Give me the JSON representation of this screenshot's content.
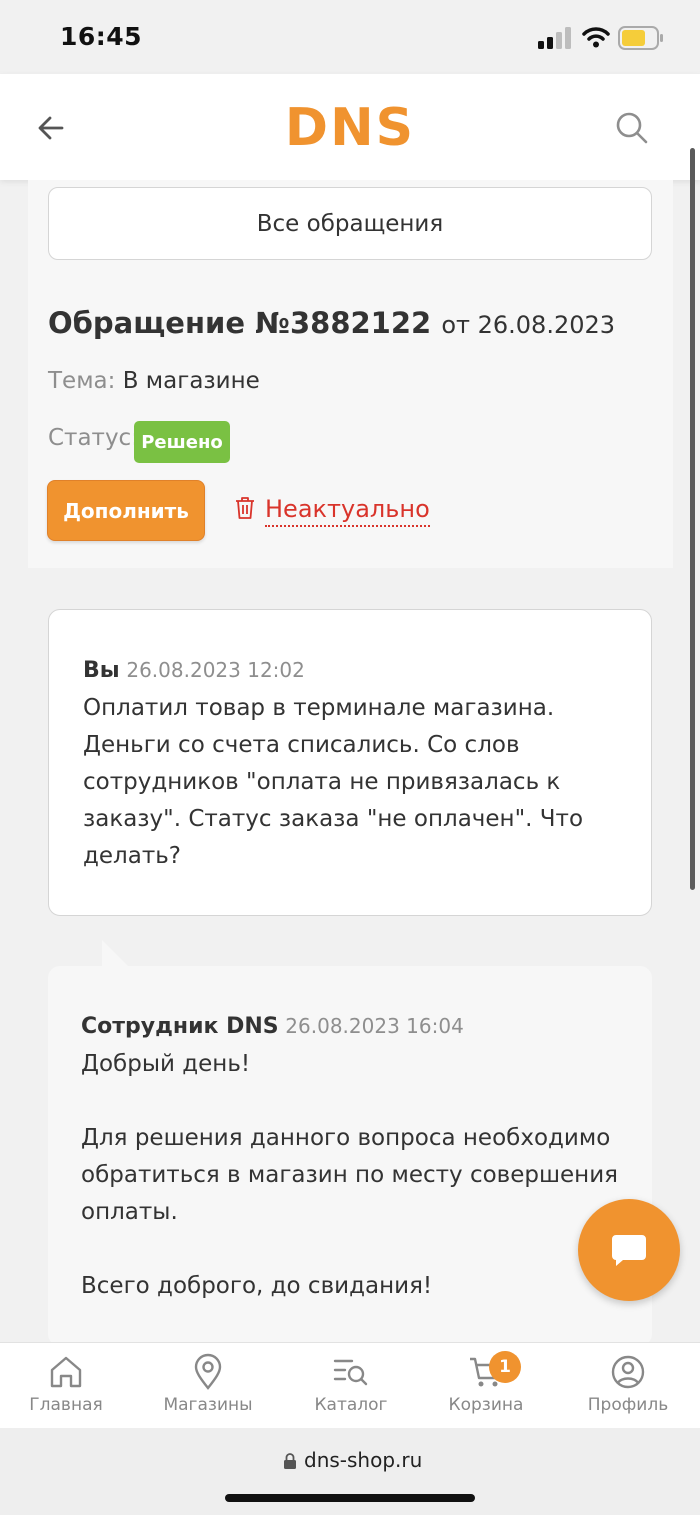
{
  "status_bar": {
    "time": "16:45"
  },
  "header": {
    "logo_text": "DNS",
    "brand_color": "#f0932f"
  },
  "top": {
    "all_requests_label": "Все обращения",
    "ticket_title": "Обращение №3882122",
    "ticket_from": "от 26.08.2023",
    "topic_label": "Тема:",
    "topic_value": "В магазине",
    "status_label": "Статус:",
    "status_value": "Решено",
    "supplement_label": "Дополнить",
    "irrelevant_label": "Неактуально"
  },
  "messages": [
    {
      "author": "Вы",
      "time": "26.08.2023 12:02",
      "lines": [
        "Оплатил товар в терминале магазина.",
        "Деньги со счета списались. Со слов",
        "сотрудников \"оплата не привязалась к",
        "заказу\". Статус заказа \"не оплачен\". Что",
        "делать?"
      ]
    },
    {
      "author": "Сотрудник DNS",
      "time": "26.08.2023 16:04",
      "lines": [
        "Добрый день!",
        "",
        "Для решения данного вопроса необходимо",
        "обратиться в магазин по месту совершения",
        "оплаты.",
        "",
        "Всего доброго, до свидания!"
      ]
    }
  ],
  "nav": {
    "items": [
      {
        "label": "Главная",
        "icon": "home-icon"
      },
      {
        "label": "Магазины",
        "icon": "map-pin-icon"
      },
      {
        "label": "Каталог",
        "icon": "catalog-search-icon"
      },
      {
        "label": "Корзина",
        "icon": "cart-icon"
      },
      {
        "label": "Профиль",
        "icon": "profile-icon"
      }
    ],
    "cart_count": "1"
  },
  "browser": {
    "url": "dns-shop.ru"
  }
}
